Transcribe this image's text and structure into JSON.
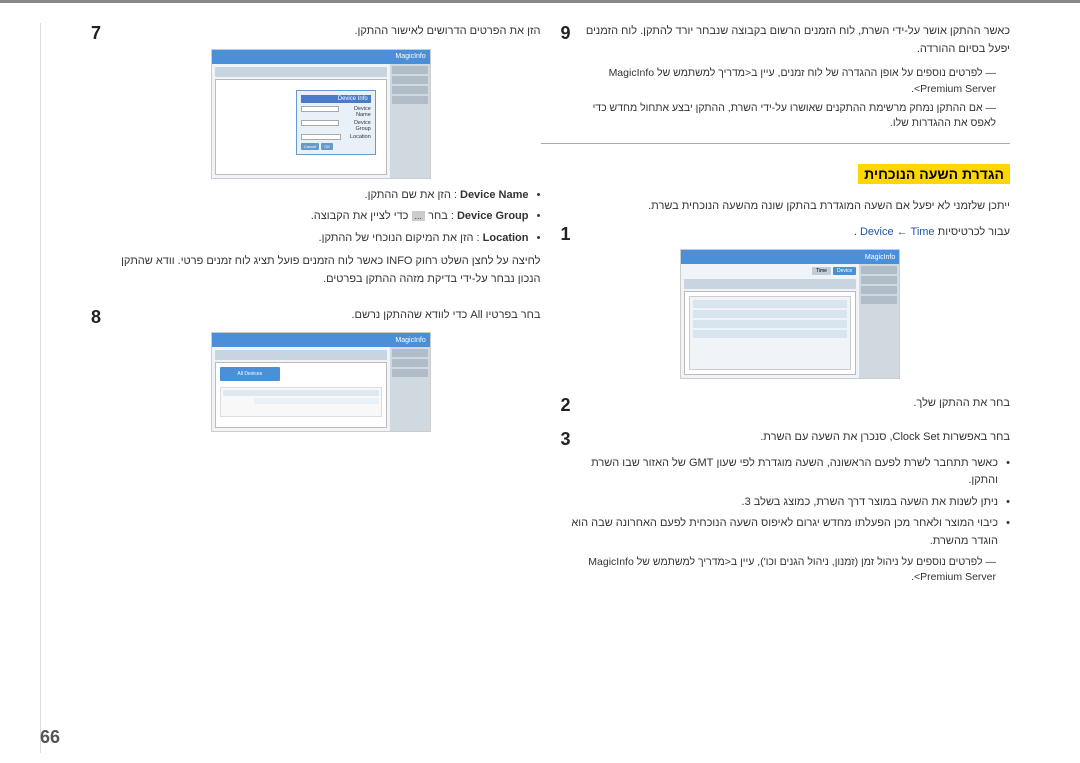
{
  "page": {
    "number": "66",
    "top_border_color": "#888"
  },
  "right_column": {
    "step7": {
      "number": "7",
      "intro_text": "הזן את הפרטים הדרושים לאישור ההתקן.",
      "bullet1_label": "Device Name",
      "bullet1_text": ": הזן את שם ההתקן.",
      "bullet2_label": "Device Group",
      "bullet2_text": ": בחר",
      "bullet2_suffix": "כדי לציין את הקבוצה.",
      "bullet2_dots": "...",
      "bullet3_label": "Location",
      "bullet3_text": ": הזן את המיקום הנוכחי של ההתקן.",
      "info_text": "לחיצה על לחצן השלט רחוק INFO כאשר לוח הזמנים פועל תציג לוח זמנים פרטי. וודא שהתקן הנכון נבחר על-ידי בדיקת מזהה ההתקן בפרטים."
    },
    "step8": {
      "number": "8",
      "text": "בחר בפרטיו All כדי לוודא שההתקן נרשם."
    }
  },
  "left_column": {
    "step9": {
      "number": "9",
      "text": "כאשר ההתקן אושר על-ידי השרת, לוח הזמנים הרשום בקבוצה שנבחר יורד להתקן. לוח הזמנים יפעל בסיום ההורדה.",
      "note1": "לפרטים נוספים על אופן ההגדרה של לוח זמנים, עיין ב<מדריך למשתמש של MagicInfo Premium Server>.",
      "note2": "אם ההתקן נמחק מרשימת ההתקנים שאושרו על-ידי השרת, ההתקן יבצע אתחול מחדש כדי לאפס את ההגדרות שלו."
    },
    "section_title": "הגדרת השעה הנוכחית",
    "intro_text": "ייתכן שלזמני לא יפעל אם השעה המוגדרת בהתקן שונה מהשעה הנוכחית בשרת.",
    "step1": {
      "number": "1",
      "text": "עבור לכרטיסיות",
      "blue_text": "Device ← Time",
      "suffix": "."
    },
    "step2": {
      "number": "2",
      "text": "בחר את ההתקן שלך."
    },
    "step3": {
      "number": "3",
      "text": "בחר באפשרות Clock Set, סנכרן את השעה עם השרת.",
      "bullet1": "כאשר תתחבר לשרת לפעם הראשונה, השעה מוגדרת לפי שעון GMT של האזור שבו השרת והתקן.",
      "bullet2": "ניתן לשנות את השעה במוצר דרך השרת, כמוצג בשלב 3.",
      "bullet3": "כיבוי המוצר ולאחר מכן הפעלתו מחדש יגרום לאיפוס השעה הנוכחית לפעם האחרונה שבה הוא הוגדר מהשרת.",
      "note": "לפרטים נוספים על ניהול זמן (זמנון, ניהול הגנים וכו'), עיין ב<מדריך למשתמש של MagicInfo Premium Server>."
    }
  }
}
